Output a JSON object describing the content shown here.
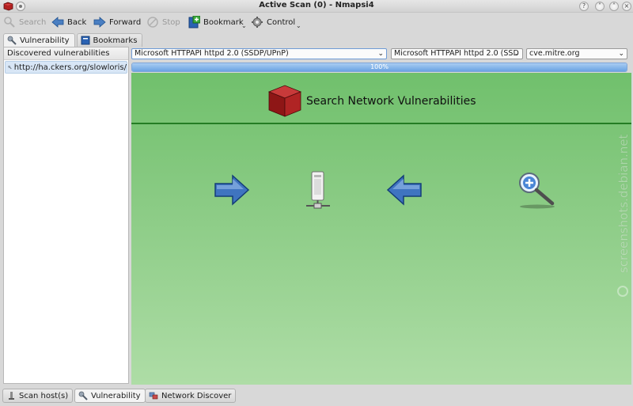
{
  "window": {
    "title": "Active Scan (0) - Nmapsi4"
  },
  "toolbar": {
    "search": "Search",
    "back": "Back",
    "forward": "Forward",
    "stop": "Stop",
    "bookmark": "Bookmark",
    "control": "Control"
  },
  "left_tabs": [
    {
      "label": "Vulnerability",
      "active": true
    },
    {
      "label": "Bookmarks",
      "active": false
    }
  ],
  "left_panel": {
    "header": "Discovered vulnerabilities",
    "items": [
      "http://ha.ckers.org/slowloris/"
    ]
  },
  "combos": {
    "service_1": "Microsoft HTTPAPI httpd 2.0 (SSDP/UPnP)",
    "service_2": "Microsoft HTTPAPI httpd 2.0 (SSD",
    "database": "cve.mitre.org"
  },
  "progress": {
    "value": 1.0,
    "label": "100%"
  },
  "webview": {
    "title": "Search Network Vulnerabilities",
    "cube_label": "Nmapsi4",
    "background": "#7ec67a",
    "rule_color": "#247d24"
  },
  "watermark": "screenshots.debian.net",
  "bottom_tabs": [
    {
      "label": "Scan host(s)",
      "active": false
    },
    {
      "label": "Vulnerability",
      "active": true
    },
    {
      "label": "Network Discover",
      "active": false
    }
  ]
}
